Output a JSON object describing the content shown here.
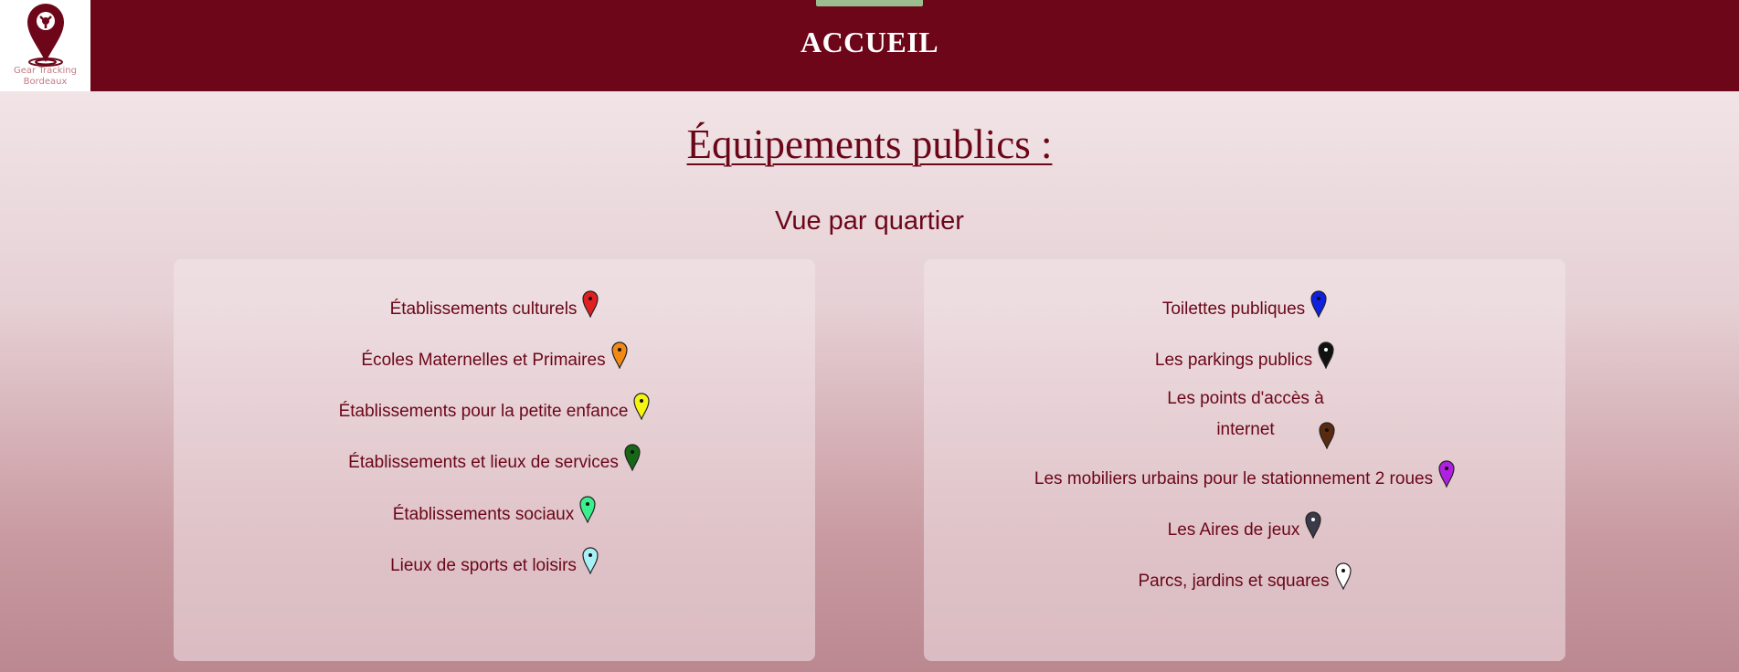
{
  "header": {
    "title": "ACCUEIL",
    "logo_text_line1": "Gear Tracking",
    "logo_text_line2": "Bordeaux",
    "logo_icon": "map-pin-logo-icon",
    "background": "#6c0618",
    "active_indicator_color": "#9bbd8f"
  },
  "main": {
    "title": "Équipements publics :",
    "subtitle": "Vue par quartier"
  },
  "left_panel": {
    "items": [
      {
        "label": "Établissements culturels",
        "pin_color": "#e02020",
        "icon": "map-pin-icon"
      },
      {
        "label": "Écoles Maternelles et Primaires",
        "pin_color": "#f08a14",
        "icon": "map-pin-icon"
      },
      {
        "label": "Établissements pour la petite enfance",
        "pin_color": "#f5f514",
        "icon": "map-pin-icon"
      },
      {
        "label": "Établissements et lieux de services",
        "pin_color": "#166816",
        "icon": "map-pin-icon"
      },
      {
        "label": "Établissements sociaux",
        "pin_color": "#3af08c",
        "icon": "map-pin-icon"
      },
      {
        "label": "Lieux de sports et loisirs",
        "pin_color": "#a8f0f5",
        "icon": "map-pin-icon"
      }
    ]
  },
  "right_panel": {
    "items": [
      {
        "label": "Toilettes publiques",
        "pin_color": "#1020e0",
        "icon": "map-pin-icon"
      },
      {
        "label": "Les parkings publics",
        "pin_color": "#111111",
        "icon": "map-pin-icon"
      },
      {
        "label": "Les points d'accès à internet",
        "pin_color": "#5a2a10",
        "icon": "map-pin-icon"
      },
      {
        "label": "Les mobiliers urbains pour le stationnement 2 roues",
        "pin_color": "#b020e0",
        "icon": "map-pin-icon"
      },
      {
        "label": "Les Aires de jeux",
        "pin_color": "#3a3a48",
        "icon": "map-pin-icon"
      },
      {
        "label": "Parcs, jardins et squares",
        "pin_color": "#ffffff",
        "icon": "map-pin-icon"
      }
    ]
  }
}
